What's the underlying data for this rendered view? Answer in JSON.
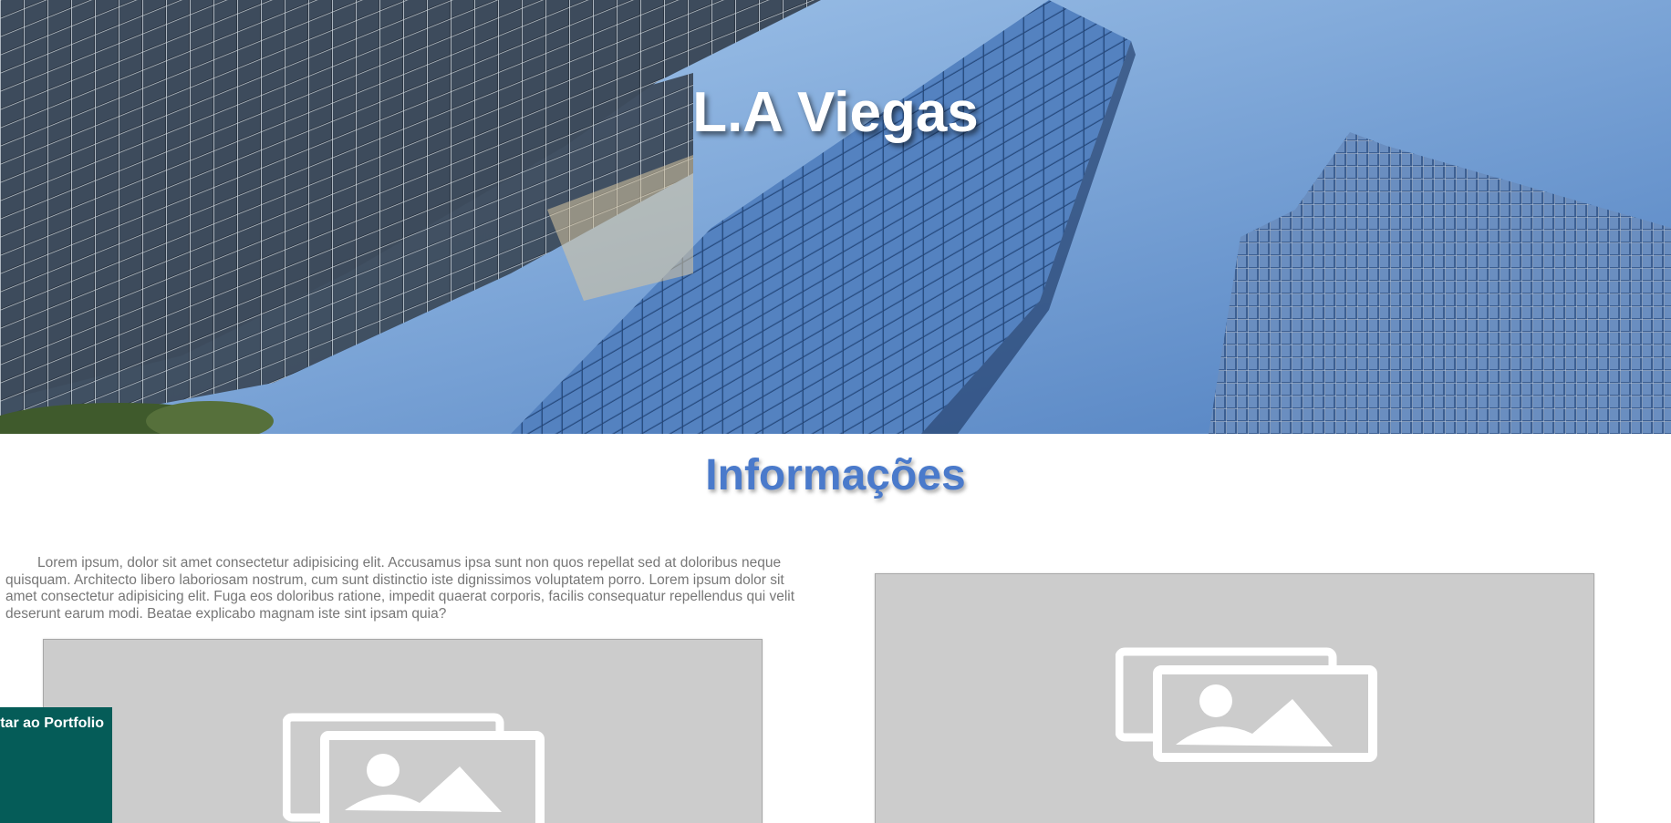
{
  "hero": {
    "title": "L.A Viegas"
  },
  "info": {
    "heading": "Informações",
    "paragraph": "Lorem ipsum, dolor sit amet consectetur adipisicing elit. Accusamus ipsa sunt non quos repellat sed at doloribus neque quisquam. Architecto libero laboriosam nostrum, cum sunt distinctio iste dignissimos voluptatem porro. Lorem ipsum dolor sit amet consectetur adipisicing elit. Fuga eos doloribus ratione, impedit quaerat corporis, facilis consequatur repellendus qui velit deserunt earum modi. Beatae explicabo magnam iste sint ipsam quia?"
  },
  "back_button": {
    "label": "Voltar ao Portfolio"
  },
  "colors": {
    "heading_blue": "#4a7acb",
    "button_green": "#055c58",
    "placeholder_gray": "#cccccc"
  },
  "icons": {
    "placeholder": "image-gallery-icon"
  }
}
